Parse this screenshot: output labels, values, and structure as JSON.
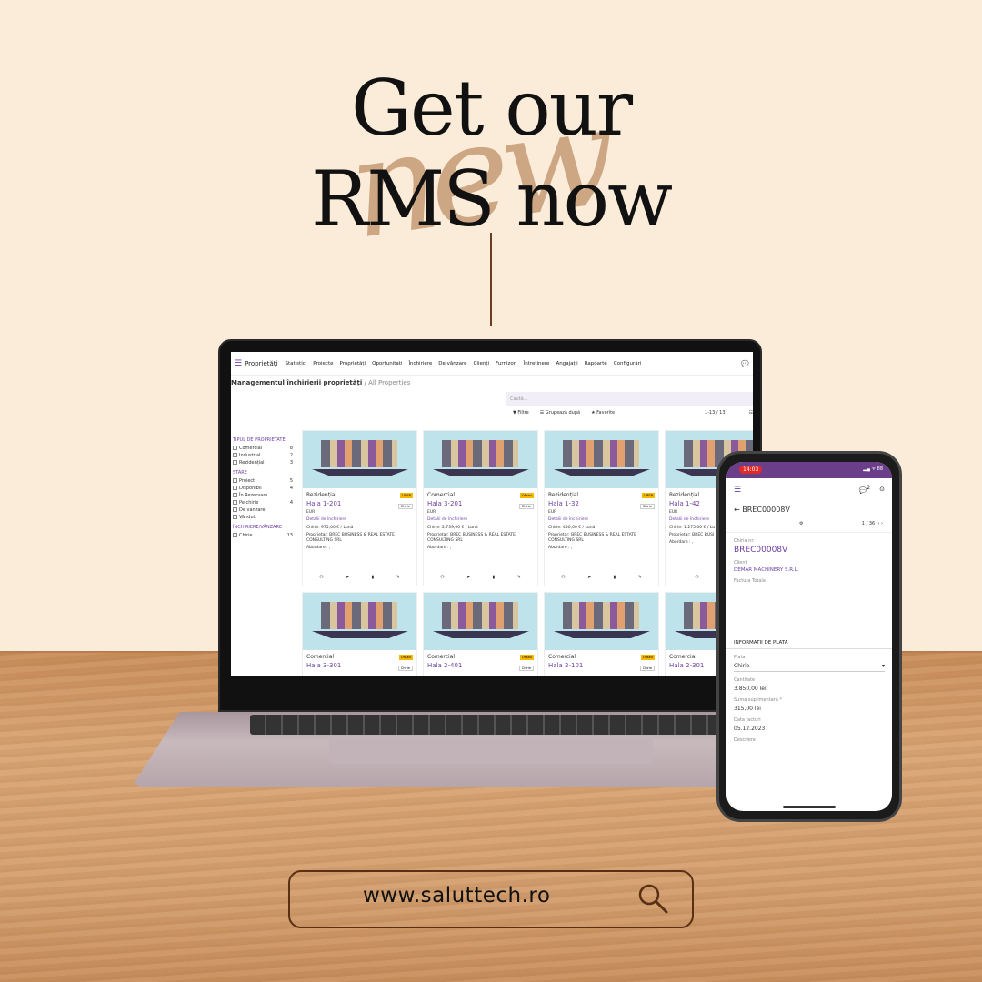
{
  "headline": {
    "line1": "Get our",
    "script_word": "new",
    "line2": "RMS now"
  },
  "website": {
    "url": "www.saluttech.ro"
  },
  "laptop_app": {
    "brand": "Proprietăți",
    "menu": [
      "Statistici",
      "Proiecte",
      "Proprietăți",
      "Oportunitati",
      "Închiriere",
      "De vânzare",
      "Clienți",
      "Furnizori",
      "Întreținere",
      "Angajații",
      "Rapoarte",
      "Configurări"
    ],
    "breadcrumb": "Managementul închirierii proprietăți",
    "breadcrumb_sub": "/ All Properties",
    "search_placeholder": "Caută...",
    "filters": {
      "filter": "▼ Filtre",
      "group": "☰ Grupează după",
      "favorites": "★ Favorite",
      "pager": "1-13 / 13"
    },
    "sidebar": {
      "sections": [
        {
          "title": "TIPUL DE PROPRIETATE",
          "items": [
            {
              "label": "Comercial",
              "count": "8"
            },
            {
              "label": "Industrial",
              "count": "2"
            },
            {
              "label": "Rezidențial",
              "count": "3"
            }
          ]
        },
        {
          "title": "STARE",
          "items": [
            {
              "label": "Proiect",
              "count": "5"
            },
            {
              "label": "Disponibil",
              "count": "4"
            },
            {
              "label": "În Rezervare",
              "count": ""
            },
            {
              "label": "Pe chirie",
              "count": "4"
            },
            {
              "label": "De vanzare",
              "count": ""
            },
            {
              "label": "Vândut",
              "count": ""
            }
          ]
        },
        {
          "title": "ÎNCHIRIERE/VÂNZARE",
          "items": [
            {
              "label": "Chirie",
              "count": "13"
            }
          ]
        }
      ]
    },
    "cards": [
      {
        "type": "Rezidențial",
        "badge": "LIBER",
        "name": "Hala 1-201",
        "tag": "Chirie",
        "cur": "EUR",
        "link": "Detalii de închiriere",
        "rent": "Chirie: 975,00 € / Lună",
        "owner": "Proprietar: BREC BUSINESS & REAL ESTATE CONSULTING SRL",
        "approach": "Abordare : ,"
      },
      {
        "type": "Comercial",
        "badge": "Ofiseu",
        "name": "Hala 3-201",
        "tag": "Chirie",
        "cur": "EUR",
        "link": "Detalii de închiriere",
        "rent": "Chirie: 2.739,00 € / Lună",
        "owner": "Proprietar: BREC BUSINESS & REAL ESTATE CONSULTING SRL",
        "approach": "Abordare : ,"
      },
      {
        "type": "Rezidențial",
        "badge": "LIBER",
        "name": "Hala 1-32",
        "tag": "Chirie",
        "cur": "EUR",
        "link": "Detalii de închiriere",
        "rent": "Chirie: 450,00 € / Lună",
        "owner": "Proprietar: BREC BUSINESS & REAL ESTATE CONSULTING SRL",
        "approach": "Abordare : ,"
      },
      {
        "type": "Rezidențial",
        "badge": "",
        "name": "Hala 1-42",
        "tag": "",
        "cur": "EUR",
        "link": "Detalii de închiriere",
        "rent": "Chirie: 1.275,00 € / Lu",
        "owner": "Proprietar: BREC BUSI ESTATE CONSULTING",
        "approach": "Abordare : ,"
      },
      {
        "type": "Comercial",
        "badge": "Ofiseu",
        "name": "Hala 3-301",
        "tag": "Chirie",
        "cur": "",
        "link": "",
        "rent": "",
        "owner": "",
        "approach": ""
      },
      {
        "type": "Comercial",
        "badge": "Ofiseu",
        "name": "Hala 2-401",
        "tag": "Chirie",
        "cur": "",
        "link": "",
        "rent": "",
        "owner": "",
        "approach": ""
      },
      {
        "type": "Comercial",
        "badge": "Ofiseu",
        "name": "Hala 2-101",
        "tag": "Chirie",
        "cur": "",
        "link": "",
        "rent": "",
        "owner": "",
        "approach": ""
      },
      {
        "type": "Comercial",
        "badge": "",
        "name": "Hala 2-301",
        "tag": "",
        "cur": "",
        "link": "",
        "rent": "",
        "owner": "",
        "approach": ""
      }
    ]
  },
  "phone_app": {
    "time": "14:03",
    "status_icons": "▂▄ ᯤ 88",
    "badge_count": "2",
    "record_title": "BREC00008V",
    "pager": "1 / 36",
    "fields": {
      "rent_no_label": "Chiria nr.",
      "rent_no": "BREC00008V",
      "client_label": "Client",
      "client": "DEMAR MACHINERY S.R.L.",
      "invoice_label": "Factura Totala",
      "payment_section": "INFORMATII DE PLATA",
      "pay_label": "Plata",
      "pay_value": "Chirie",
      "amount_label": "Cantitate",
      "amount": "3.850,00 lei",
      "extra_label": "Suma suplimentară *",
      "extra": "315,00 lei",
      "date_label": "Data facturi",
      "date": "05.12.2023",
      "desc_label": "Descriere"
    }
  }
}
